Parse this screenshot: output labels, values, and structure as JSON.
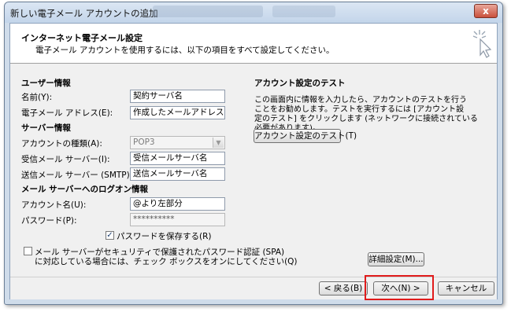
{
  "window": {
    "title": "新しい電子メール アカウントの追加",
    "close_label": "x"
  },
  "header": {
    "title": "インターネット電子メール設定",
    "subtitle": "電子メール アカウントを使用するには、以下の項目をすべて設定してください。"
  },
  "user_info": {
    "section": "ユーザー情報",
    "name_label": "名前(Y):",
    "name_value": "契約サーバ名",
    "email_label": "電子メール アドレス(E):",
    "email_value": "作成したメールアドレス"
  },
  "server_info": {
    "section": "サーバー情報",
    "account_type_label": "アカウントの種類(A):",
    "account_type_value": "POP3",
    "incoming_label": "受信メール サーバー(I):",
    "incoming_value": "受信メールサーバ名",
    "outgoing_label": "送信メール サーバー (SMTP)(O):",
    "outgoing_value": "送信メールサーバ名"
  },
  "logon_info": {
    "section": "メール サーバーへのログオン情報",
    "account_label": "アカウント名(U):",
    "account_value": "@より左部分",
    "password_label": "パスワード(P):",
    "password_value": "**********",
    "remember_label": "パスワードを保存する(R)",
    "remember_checked": true,
    "spa_label_line1": "メール サーバーがセキュリティで保護されたパスワード認証 (SPA)",
    "spa_label_line2": "に対応している場合には、チェック ボックスをオンにしてください(Q)",
    "spa_checked": false
  },
  "test": {
    "section": "アカウント設定のテスト",
    "desc_line1": "この画面内に情報を入力したら、アカウントのテストを行う",
    "desc_line2": "ことをお勧めします。テストを実行するには [アカウント設",
    "desc_line3": "定のテスト] をクリックします (ネットワークに接続されている",
    "desc_line4": "必要があります)。",
    "test_button": "アカウント設定のテスト(T)",
    "advanced_button": "詳細設定(M)..."
  },
  "footer": {
    "back_button": "< 戻る(B)",
    "next_button": "次へ(N) >",
    "cancel_button": "キャンセル"
  },
  "colors": {
    "highlight": "#e01b1b",
    "window_frame": "#cfdcea"
  }
}
